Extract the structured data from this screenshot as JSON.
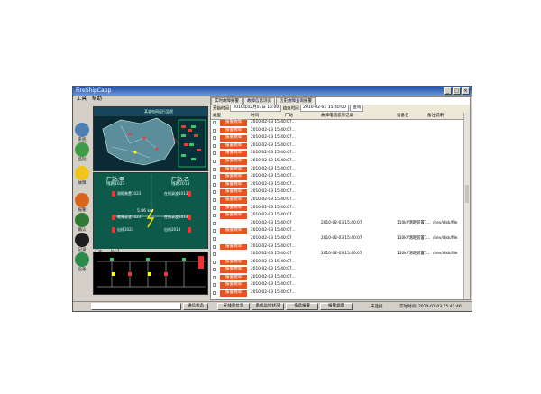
{
  "window": {
    "title": "FireShipCapp"
  },
  "menu": [
    "工具",
    "帮助"
  ],
  "rail": [
    {
      "icon": "globe-icon",
      "label": "系统",
      "color": "#4d7fb3"
    },
    {
      "icon": "monitor-icon",
      "label": "监控",
      "color": "#3f9c47"
    },
    {
      "icon": "lightning-icon",
      "label": "故障",
      "color": "#f0c419"
    },
    {
      "icon": "alarm-icon",
      "label": "报警",
      "color": "#d9641c"
    },
    {
      "icon": "ok-icon",
      "label": "确认",
      "color": "#2f7a34"
    },
    {
      "icon": "record-icon",
      "label": "记录",
      "color": "#1d1d1d"
    },
    {
      "icon": "device-icon",
      "label": "设备",
      "color": "#2c8b4a"
    }
  ],
  "map": {
    "header": "某省电网运行监视"
  },
  "substation": {
    "left_title": "厂站:甲",
    "left_sub": "线路1023",
    "right_title": "厂站:乙",
    "right_sub": "线路2013",
    "items_left": [
      "测距装置1023",
      "故障录波1023",
      "出线1023"
    ],
    "items_right": [
      "在线录波1013",
      "在线录波2013",
      "出线2013"
    ],
    "distance": "5.86 km"
  },
  "diagram": {
    "tab1": "厂站",
    "tab2": "Ioc-1"
  },
  "right_panel": {
    "tabs": [
      "实时故障报警",
      "故障信息浏览",
      "历史故障查询报警"
    ],
    "filter": {
      "label_from": "开始时间",
      "from_value": "2010年02月03日 15:00",
      "label_to": "结束时间",
      "to_value": "2010-02-03 15:40:00",
      "query": "查询"
    },
    "columns": [
      "类型",
      "时间",
      "厂站",
      "故障电流波形记录",
      "设备名",
      "备注说明"
    ],
    "badge_text": "报警故障",
    "rows": [
      {
        "badge": true,
        "time": "2010-02-03 15:40:07..."
      },
      {
        "badge": true,
        "time": "2010-02-03 15:40:07..."
      },
      {
        "badge": true,
        "time": "2010-02-03 15:40:07..."
      },
      {
        "badge": true,
        "time": "2010-02-03 15:40:07..."
      },
      {
        "badge": true,
        "time": "2010-02-03 15:40:07..."
      },
      {
        "badge": true,
        "time": "2010-02-03 15:40:07..."
      },
      {
        "badge": true,
        "time": "2010-02-03 15:40:07..."
      },
      {
        "badge": true,
        "time": "2010-02-03 15:40:07..."
      },
      {
        "badge": true,
        "time": "2010-02-03 15:40:07..."
      },
      {
        "badge": true,
        "time": "2010-02-03 15:40:07..."
      },
      {
        "badge": true,
        "time": "2010-02-03 15:40:07..."
      },
      {
        "badge": true,
        "time": "2010-02-03 15:40:07..."
      },
      {
        "badge": true,
        "time": "2010-02-03 15:40:07..."
      },
      {
        "badge": false,
        "time": "2010-02-03 15:40:07",
        "col3": "2010-02-03 15:40:07",
        "col4": "110kV测距装置1...",
        "col5": "/dev/disk/file"
      },
      {
        "badge": true,
        "time": "2010-02-03 15:40:07..."
      },
      {
        "badge": false,
        "time": "2010-02-03 15:40:07",
        "col3": "2010-02-03 15:40:07",
        "col4": "110kV测距装置1...",
        "col5": "/dev/disk/file"
      },
      {
        "badge": true,
        "time": "2010-02-03 15:40:07..."
      },
      {
        "badge": false,
        "time": "2010-02-03 15:40:07",
        "col3": "2010-02-03 15:40:07",
        "col4": "110kV测距装置1...",
        "col5": "/dev/disk/file"
      },
      {
        "badge": true,
        "time": "2010-02-03 15:40:07..."
      },
      {
        "badge": true,
        "time": "2010-02-03 15:40:07..."
      },
      {
        "badge": true,
        "time": "2010-02-03 15:40:07..."
      },
      {
        "badge": true,
        "time": "2010-02-03 15:40:07..."
      },
      {
        "badge": true,
        "time": "2010-02-03 15:40:07..."
      }
    ]
  },
  "statusbar": {
    "buttons": [
      "通信状态",
      "在线单位浏",
      "系统运行状况",
      "多选报警",
      "报警调度"
    ],
    "right_label": "未连接",
    "right_time": "实时时间: 2010-02-03 15:41:46"
  },
  "colors": {
    "badge": "#e8541e",
    "titlebar": "#1e4fa8",
    "sub_bg": "#0e5a4a"
  }
}
